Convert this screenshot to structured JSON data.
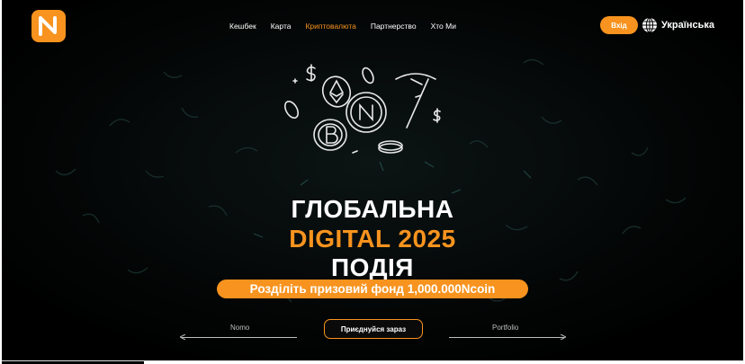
{
  "brand": {
    "logo_letter": "N",
    "accent": "#f7931e",
    "background": "#000000"
  },
  "nav": {
    "items": [
      {
        "label": "Кешбек",
        "active": false
      },
      {
        "label": "Карта",
        "active": false
      },
      {
        "label": "Криптовалюта",
        "active": true
      },
      {
        "label": "Партнерство",
        "active": false
      },
      {
        "label": "Хто Ми",
        "active": false
      }
    ]
  },
  "header": {
    "login_label": "Вхід",
    "language_label": "Українська",
    "language_icon": "globe-icon"
  },
  "hero": {
    "illustration_icons": [
      "coin-icon",
      "bitcoin-icon",
      "ethereum-icon",
      "pickaxe-icon",
      "dollar-icon"
    ],
    "line1": "ГЛОБАЛЬНА",
    "line2": "DIGITAL 2025",
    "line3": "ПОДІЯ",
    "prize_text": "Розділіть призовий фонд 1,000.000Ncoin"
  },
  "bottom": {
    "left_link": "Nomo",
    "cta_label": "Приєднуйся зараз",
    "right_link": "Portfolio"
  }
}
